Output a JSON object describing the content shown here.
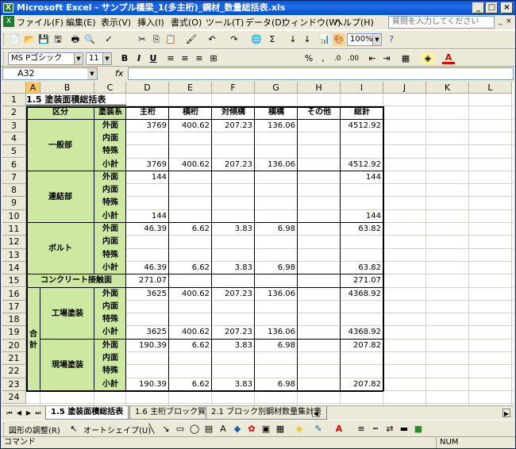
{
  "window": {
    "title": "Microsoft Excel - サンプル橋梁_1(多主桁)_鋼材_数量総括表.xls",
    "icon_text": "X"
  },
  "title_buttons": [
    "_",
    "□",
    "×"
  ],
  "menu": {
    "items": [
      "ファイル(F)",
      "編集(E)",
      "表示(V)",
      "挿入(I)",
      "書式(O)",
      "ツール(T)",
      "データ(D)",
      "ウィンドウ(W)",
      "ヘルプ(H)"
    ],
    "help_placeholder": "質問を入力してください",
    "doc_buttons": [
      "_",
      "□",
      "×"
    ]
  },
  "standard_toolbar": {
    "icons": [
      "📄",
      "📂",
      "💾",
      "🖫",
      "🖶",
      "🔍",
      "✓",
      "✂",
      "⎘",
      "📋",
      "🖌",
      "↶",
      "↷",
      "🌐",
      "Σ",
      "↓",
      "↓",
      "📊",
      "🎨"
    ],
    "zoom": "100%",
    "help_icon": "?"
  },
  "format_toolbar": {
    "font": "MS Pゴシック",
    "size": "11",
    "buttons": [
      "B",
      "I",
      "U",
      "≡",
      "≡",
      "≡",
      "⊞",
      "%",
      ",",
      ".0",
      ".00",
      "⇤",
      "⇥",
      "▦",
      "A"
    ]
  },
  "formula_bar": {
    "name_box": "A32",
    "fx": "fx",
    "value": ""
  },
  "columns": [
    "A",
    "B",
    "C",
    "D",
    "E",
    "F",
    "G",
    "H",
    "I",
    "J",
    "K",
    "L"
  ],
  "rows": [
    "1",
    "2",
    "3",
    "4",
    "5",
    "6",
    "7",
    "8",
    "9",
    "10",
    "11",
    "12",
    "13",
    "14",
    "15",
    "16",
    "17",
    "18",
    "19",
    "20",
    "21",
    "22",
    "23",
    "24"
  ],
  "sheet_title": "1.5 塗装面積総括表",
  "headers": {
    "category": "区分",
    "paint": "塗装系",
    "main": "主桁",
    "cross": "横桁",
    "sway": "対傾構",
    "lateral": "横構",
    "other": "その他",
    "total": "総計"
  },
  "groups": {
    "general": "一般部",
    "joint": "連結部",
    "bolt": "ボルト",
    "concrete": "コンクリート接触面",
    "summary": "合計",
    "factory": "工場塗装",
    "site": "現場塗装"
  },
  "paint_types": [
    "外面",
    "内面",
    "特殊",
    "小計"
  ],
  "values": {
    "general": [
      [
        "3769",
        "400.62",
        "207.23",
        "136.06",
        "",
        "4512.92"
      ],
      [
        "",
        "",
        "",
        "",
        "",
        ""
      ],
      [
        "",
        "",
        "",
        "",
        "",
        ""
      ],
      [
        "3769",
        "400.62",
        "207.23",
        "136.06",
        "",
        "4512.92"
      ]
    ],
    "joint": [
      [
        "144",
        "",
        "",
        "",
        "",
        "144"
      ],
      [
        "",
        "",
        "",
        "",
        "",
        ""
      ],
      [
        "",
        "",
        "",
        "",
        "",
        ""
      ],
      [
        "144",
        "",
        "",
        "",
        "",
        "144"
      ]
    ],
    "bolt": [
      [
        "46.39",
        "6.62",
        "3.83",
        "6.98",
        "",
        "63.82"
      ],
      [
        "",
        "",
        "",
        "",
        "",
        ""
      ],
      [
        "",
        "",
        "",
        "",
        "",
        ""
      ],
      [
        "46.39",
        "6.62",
        "3.83",
        "6.98",
        "",
        "63.82"
      ]
    ],
    "concrete": [
      "271.07",
      "",
      "",
      "",
      "",
      "271.07"
    ],
    "factory": [
      [
        "3625",
        "400.62",
        "207.23",
        "136.06",
        "",
        "4368.92"
      ],
      [
        "",
        "",
        "",
        "",
        "",
        ""
      ],
      [
        "",
        "",
        "",
        "",
        "",
        ""
      ],
      [
        "3625",
        "400.62",
        "207.23",
        "136.06",
        "",
        "4368.92"
      ]
    ],
    "site": [
      [
        "190.39",
        "6.62",
        "3.83",
        "6.98",
        "",
        "207.82"
      ],
      [
        "",
        "",
        "",
        "",
        "",
        ""
      ],
      [
        "",
        "",
        "",
        "",
        "",
        ""
      ],
      [
        "190.39",
        "6.62",
        "3.83",
        "6.98",
        "",
        "207.82"
      ]
    ]
  },
  "tabs": [
    "1.5 塗装面積総括表",
    "1.6 主桁ブロック質量",
    "2.1 ブロック別鋼材数量集計表"
  ],
  "tab_nav": [
    "⏮",
    "◀",
    "▶",
    "⏭"
  ],
  "draw_toolbar": {
    "draw_label": "図形の調整(R)",
    "autoshape_label": "オートシェイプ(U)"
  },
  "status": {
    "left": "コマンド",
    "num": "NUM"
  },
  "colors": {
    "green": "#cde8a0",
    "title_blue": "#0a58d8"
  }
}
